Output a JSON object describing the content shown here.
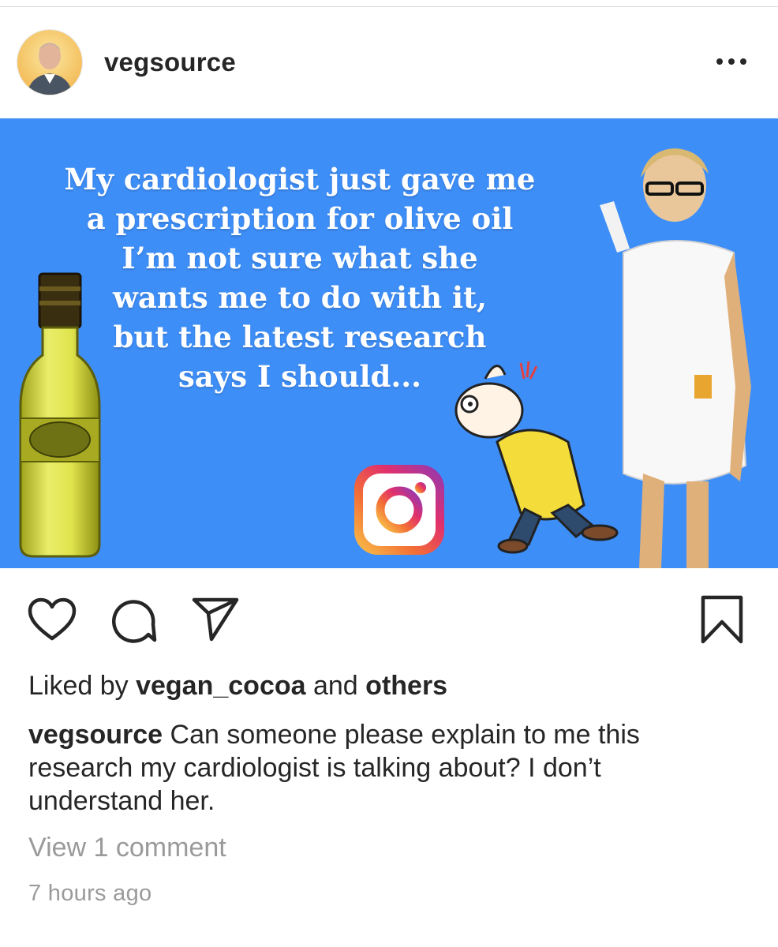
{
  "post": {
    "username": "vegsource",
    "more_icon": "more-horizontal-icon",
    "avatar_alt": "profile photo"
  },
  "image": {
    "bg_color": "#3e8ef7",
    "meme_lines": [
      "My cardiologist just gave me",
      "a prescription for olive oil",
      "I’m not sure what she",
      "wants me to do with it,",
      "but the latest research",
      "says I should..."
    ]
  },
  "actions": {
    "like_icon": "heart-icon",
    "comment_icon": "comment-icon",
    "share_icon": "send-icon",
    "save_icon": "bookmark-icon"
  },
  "likes": {
    "prefix": "Liked by ",
    "user": "vegan_cocoa",
    "middle": " and ",
    "others": "others"
  },
  "caption": {
    "username": "vegsource",
    "text": " Can someone please explain to me this research my cardiologist is talking about? I don’t understand her."
  },
  "comments": {
    "view_label": "View 1 comment"
  },
  "timestamp": "7 hours ago"
}
